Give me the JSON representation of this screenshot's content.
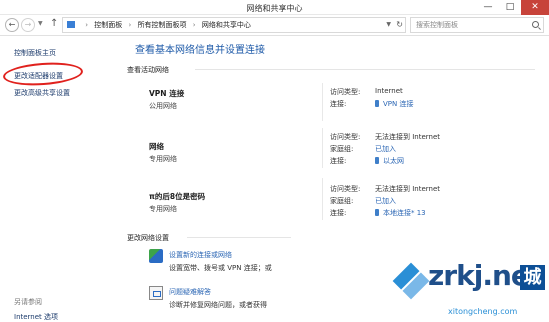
{
  "window": {
    "title": "网络和共享中心",
    "minimize": "—",
    "maximize": "□",
    "close": "✕"
  },
  "addressbar": {
    "back": "←",
    "forward": "→",
    "up": "↑",
    "breadcrumb": [
      "控制面板",
      "所有控制面板项",
      "网络和共享中心"
    ],
    "separator": "›",
    "search_placeholder": "搜索控制面板"
  },
  "leftnav": {
    "home": "控制面板主页",
    "change_adapter": "更改适配器设置",
    "change_sharing": "更改高级共享设置",
    "see_also": "另请参阅",
    "internet_options": "Internet 选项"
  },
  "main": {
    "title": "查看基本网络信息并设置连接",
    "active_networks_label": "查看活动网络",
    "networks": [
      {
        "name": "VPN 连接",
        "type": "公用网络",
        "access_type_label": "访问类型:",
        "access_type": "Internet",
        "connection_label": "连接:",
        "connection": "VPN 连接"
      },
      {
        "name": "网络",
        "type": "专用网络",
        "access_type_label": "访问类型:",
        "access_type": "无法连接到 Internet",
        "homegroup_label": "家庭组:",
        "homegroup": "已加入",
        "connection_label": "连接:",
        "connection": "以太网"
      },
      {
        "name": "π的后8位是密码",
        "type": "专用网络",
        "access_type_label": "访问类型:",
        "access_type": "无法连接到 Internet",
        "homegroup_label": "家庭组:",
        "homegroup": "已加入",
        "connection_label": "连接:",
        "connection": "本地连接* 13"
      }
    ],
    "change_settings_label": "更改网络设置",
    "tasks": [
      {
        "title": "设置新的连接或网络",
        "description": "设置宽带、拨号或 VPN 连接；或"
      },
      {
        "title": "问题疑难解答",
        "description": "诊断并修复网络问题，或者获得"
      }
    ]
  },
  "watermark": {
    "brand": "zrkj.net",
    "badge": "城",
    "sub": "xitongcheng.com"
  },
  "colors": {
    "link": "#2b66b4",
    "title": "#1e5aa8",
    "highlight_circle": "#e0211d",
    "close_button": "#c7433a"
  }
}
